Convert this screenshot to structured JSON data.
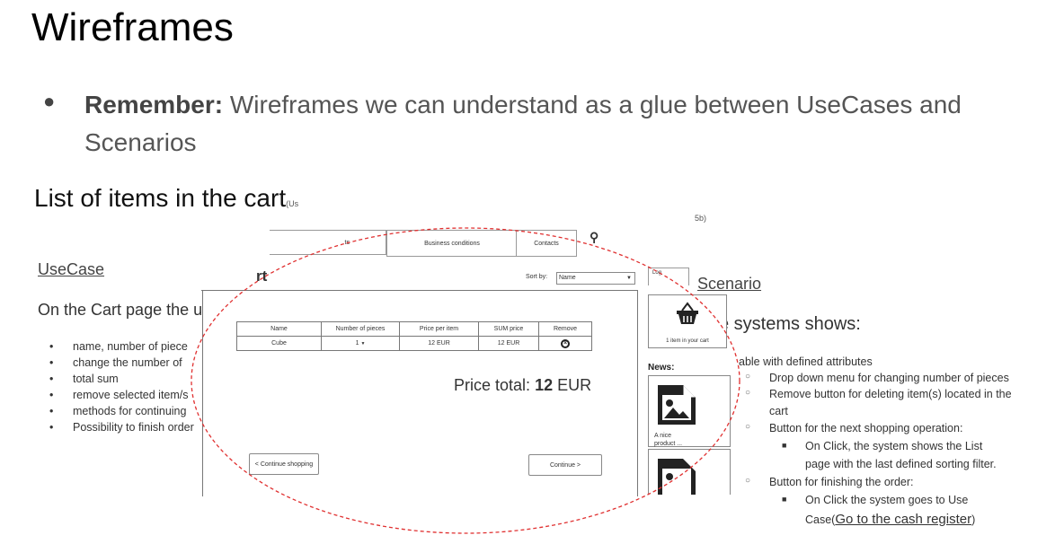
{
  "slide": {
    "title": "Wireframes",
    "remember_label": "Remember:",
    "remember_text": " Wireframes we can understand as a glue between UseCases and Scenarios",
    "subtitle": "List of items in the cart",
    "subtitle_small": "(Us",
    "tag_5b": "5b)"
  },
  "usecase": {
    "link": "UseCase",
    "description": "On the Cart page the u",
    "items": [
      "name, number of piece",
      "change the number of",
      "total sum",
      "remove selected item/s",
      "methods for continuing",
      "Possibility to  finish order"
    ]
  },
  "scenario": {
    "link": "Scenario",
    "shows": "e systems shows:",
    "line_table": "able with defined attributes",
    "sub1": "Drop down menu for changing number of pieces",
    "sub2": "Remove button for deleting item(s) located in the",
    "sub2_cont": "cart",
    "sub3": "Button for the next shopping operation:",
    "sub3_a": "On Click, the system shows the List",
    "sub3_a_cont": "page with the last defined sorting filter.",
    "sub4": "Button for finishing the order:",
    "sub4_a": "On Click the system goes to Use",
    "sub4_a_prefix": "Case(",
    "sub4_a_link": "Go to the cash register",
    "sub4_a_suffix": ")"
  },
  "wireframe": {
    "nav": [
      "ts",
      "Business conditions",
      "Contacts"
    ],
    "page_title_fragment": "rt",
    "sort_label": "Sort by:",
    "sort_value": "Name",
    "login_fragment": "Log",
    "table_headers": [
      "Name",
      "Number of pieces",
      "Price per item",
      "SUM price",
      "Remove"
    ],
    "row": {
      "name": "Cube",
      "pieces": "1",
      "price": "12 EUR",
      "sum": "12 EUR"
    },
    "price_total_label": "Price total:",
    "price_total_value": "12",
    "price_total_currency": "EUR",
    "continue_shopping": "< Continue shopping",
    "continue": "Continue >",
    "cart_caption": "1 item in your cart",
    "news_title": "News:",
    "product_caption_1": "A nice",
    "product_caption_2": "product ..."
  },
  "colors": {
    "ellipse": "#e03030",
    "link": "#444444"
  }
}
